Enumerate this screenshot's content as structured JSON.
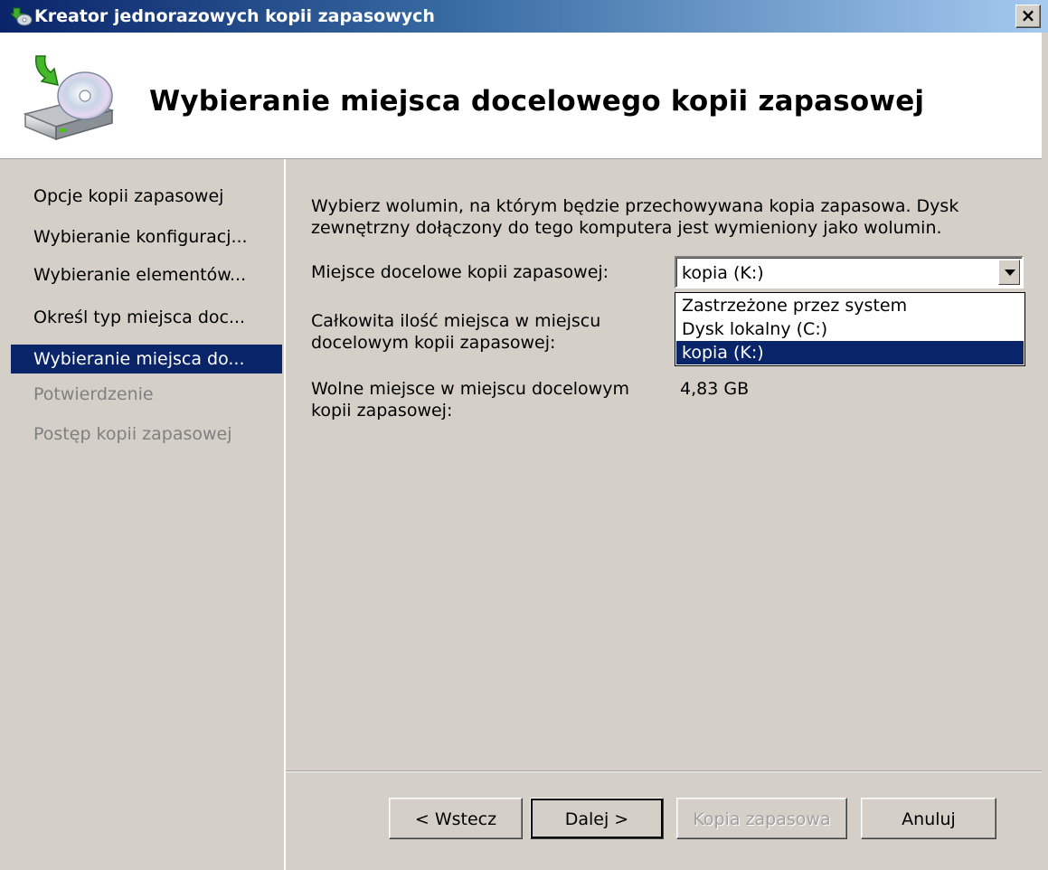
{
  "window": {
    "title": "Kreator jednorazowych kopii zapasowych",
    "close_label": "×"
  },
  "header": {
    "heading": "Wybieranie miejsca docelowego kopii zapasowej"
  },
  "nav": {
    "items": [
      {
        "label": "Opcje kopii zapasowej",
        "state": "normal"
      },
      {
        "label": "Wybieranie konfiguracj...",
        "state": "normal"
      },
      {
        "label": "Wybieranie elementów...",
        "state": "normal"
      },
      {
        "label": "Określ typ miejsca doc...",
        "state": "normal"
      },
      {
        "label": "Wybieranie miejsca do...",
        "state": "active"
      },
      {
        "label": "Potwierdzenie",
        "state": "disabled"
      },
      {
        "label": "Postęp kopii zapasowej",
        "state": "disabled"
      }
    ]
  },
  "content": {
    "intro_line1": "Wybierz wolumin, na którym będzie przechowywana kopia zapasowa. Dysk",
    "intro_line2": "zewnętrzny dołączony do tego komputera jest wymieniony jako wolumin.",
    "destination_label": "Miejsce docelowe kopii zapasowej:",
    "destination_value": "kopia (K:)",
    "destination_options": [
      "Zastrzeżone przez system",
      "Dysk lokalny (C:)",
      "kopia (K:)"
    ],
    "total_label_line1": "Całkowita ilość miejsca w miejscu",
    "total_label_line2": "docelowym kopii zapasowej:",
    "free_label_line1": "Wolne miejsce w miejscu docelowym",
    "free_label_line2": "kopii zapasowej:",
    "free_value": "4,83 GB"
  },
  "buttons": {
    "back": "< Wstecz",
    "next": "Dalej >",
    "backup": "Kopia zapasowa",
    "cancel": "Anuluj"
  },
  "colors": {
    "selection": "#0a246a",
    "face": "#d4d0c8"
  },
  "icons": {
    "title_icon": "backup-wizard-icon",
    "header_icon": "backup-drive-disc-icon"
  }
}
